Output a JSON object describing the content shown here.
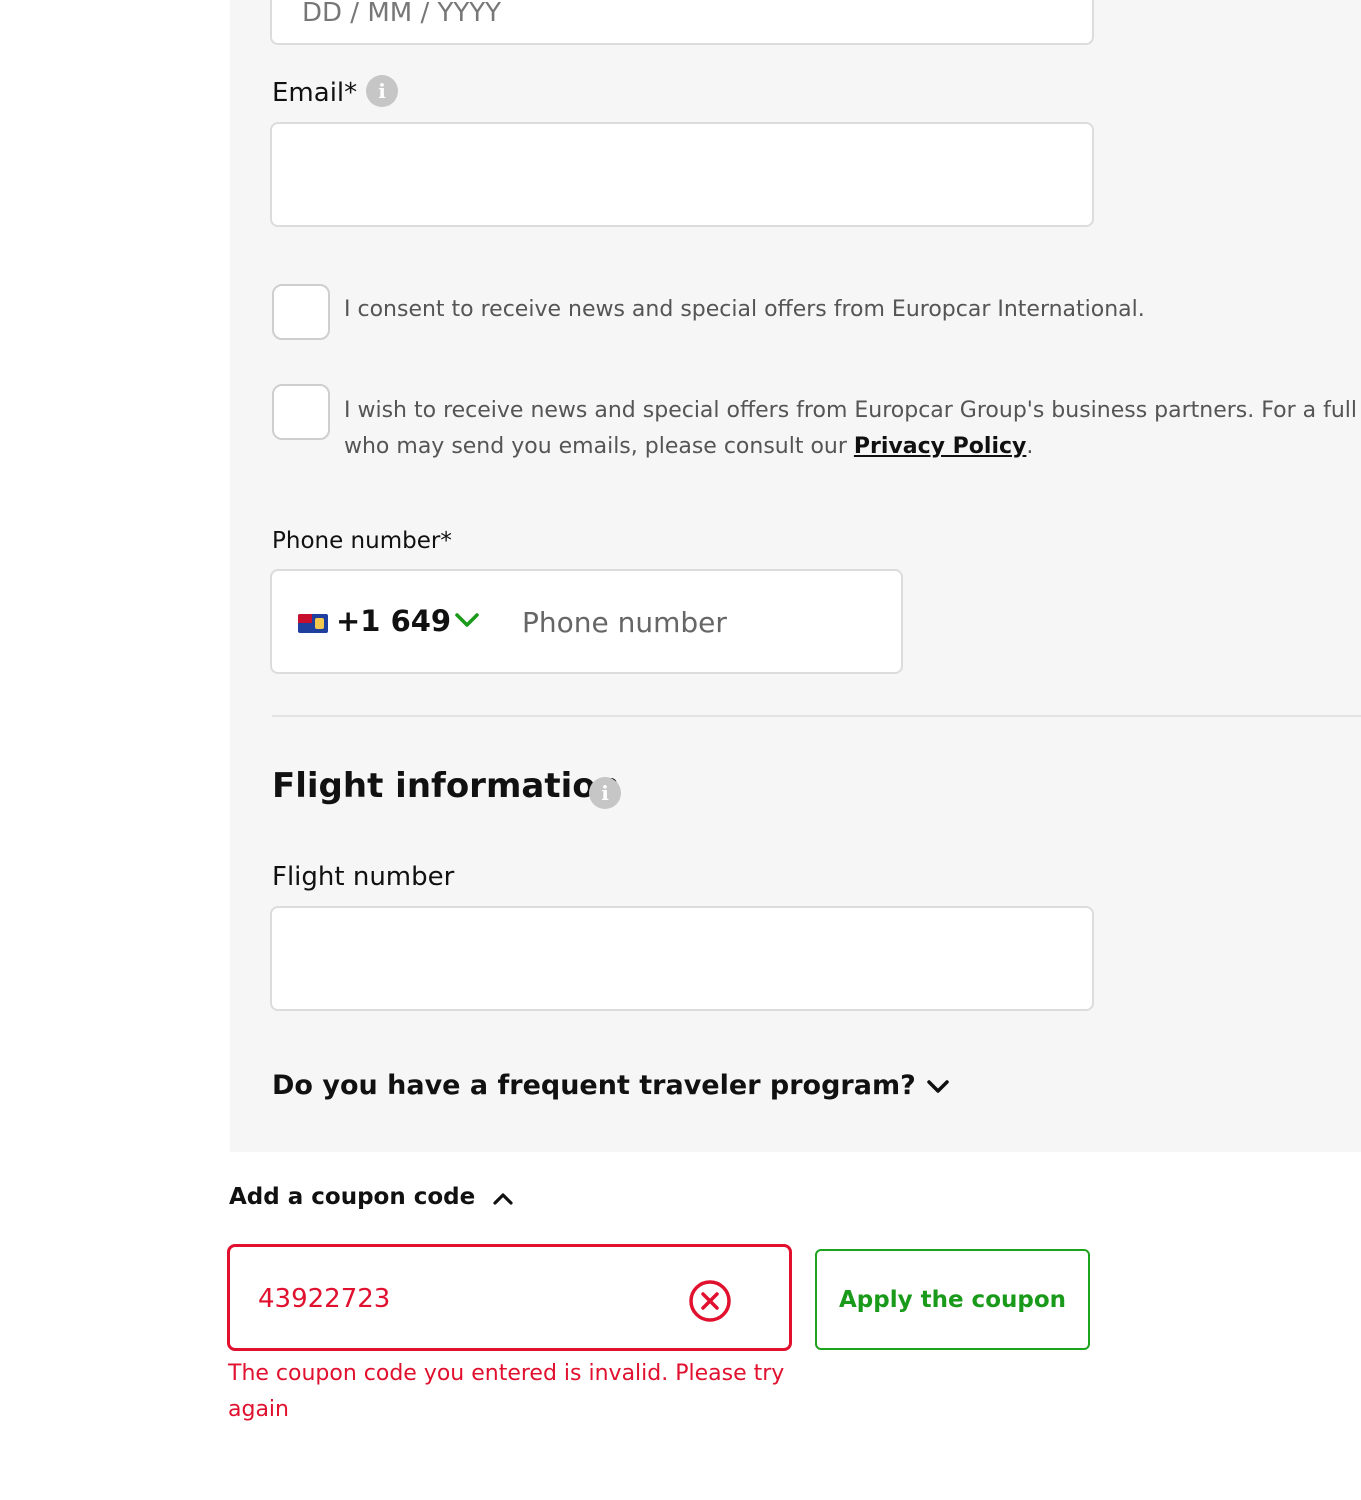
{
  "personal": {
    "dob_placeholder": "DD / MM / YYYY",
    "email_label": "Email*",
    "email_value": "",
    "info_glyph": "i"
  },
  "consents": [
    {
      "text": "I consent to receive news and special offers from Europcar International.",
      "checked": false
    },
    {
      "text_line1": "I wish to receive news and special offers from Europcar Group's business partners. For a full",
      "text_line2_prefix": "who may send you emails, please consult our ",
      "link_text": "Privacy Policy",
      "text_line2_suffix": ".",
      "checked": false
    }
  ],
  "phone": {
    "label": "Phone number*",
    "country_flag": "turks-and-caicos-flag-icon",
    "dial_code": "+1 649",
    "placeholder": "Phone number",
    "chevron_color": "#1a9a1a"
  },
  "flight": {
    "title": "Flight information",
    "number_label": "Flight number",
    "number_value": ""
  },
  "frequent_traveler": {
    "label": "Do you have a frequent traveler program?",
    "expanded": false
  },
  "coupon": {
    "toggle_label": "Add a coupon code",
    "expanded": true,
    "value": "43922723",
    "apply_label": "Apply the coupon",
    "error": "The coupon code you entered is invalid. Please try again",
    "error_color": "#e0102e",
    "accent_color": "#1a9a1a"
  }
}
